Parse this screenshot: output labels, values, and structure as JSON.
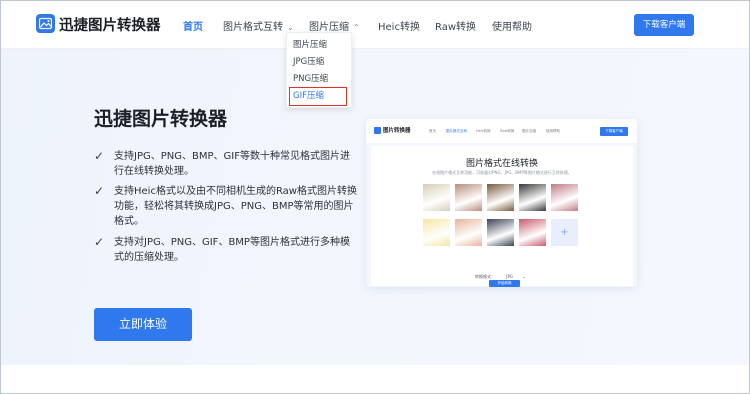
{
  "header": {
    "brand": "迅捷图片转换器",
    "nav": [
      {
        "label": "首页",
        "active": true
      },
      {
        "label": "图片格式互转",
        "caret": "chevron-down-icon"
      },
      {
        "label": "图片压缩",
        "caret": "chevron-up-icon"
      },
      {
        "label": "Heic转换"
      },
      {
        "label": "Raw转换"
      },
      {
        "label": "使用帮助"
      }
    ],
    "download_label": "下载客户端"
  },
  "dropdown": {
    "items": [
      "图片压缩",
      "JPG压缩",
      "PNG压缩",
      "GIF压缩"
    ],
    "highlighted": "GIF压缩"
  },
  "hero": {
    "title": "迅捷图片转换器",
    "features": [
      "支持JPG、PNG、BMP、GIF等数十种常见格式图片进行在线转换处理。",
      "支持Heic格式以及由不同相机生成的Raw格式图片转换功能，轻松将其转换成JPG、PNG、BMP等常用的图片格式。",
      "支持对JPG、PNG、GIF、BMP等图片格式进行多种模式的压缩处理。"
    ],
    "cta_label": "立即体验"
  },
  "preview": {
    "brand": "图片转换器",
    "nav": [
      "首页",
      "图片格式互转",
      "Heic转换",
      "Raw转换",
      "图片压缩",
      "使用帮助"
    ],
    "download_label": "下载客户端",
    "title": "图片格式在线转换",
    "subtitle": "在线图片格式互转功能，可批量对PNG、JPG、BMP等图片格式进行互转处理。",
    "format_label": "转换格式：",
    "format_value": "JPG",
    "start_label": "开始转换",
    "thumb_colors": [
      "#d9cdb8",
      "#b98c7a",
      "#7a5a3c",
      "#3b3a38",
      "#c07b84",
      "#f4e7a0",
      "#e7b49a",
      "#3a4254",
      "#c9596a",
      "#d2a48a"
    ],
    "accent": "#2f78ee"
  }
}
